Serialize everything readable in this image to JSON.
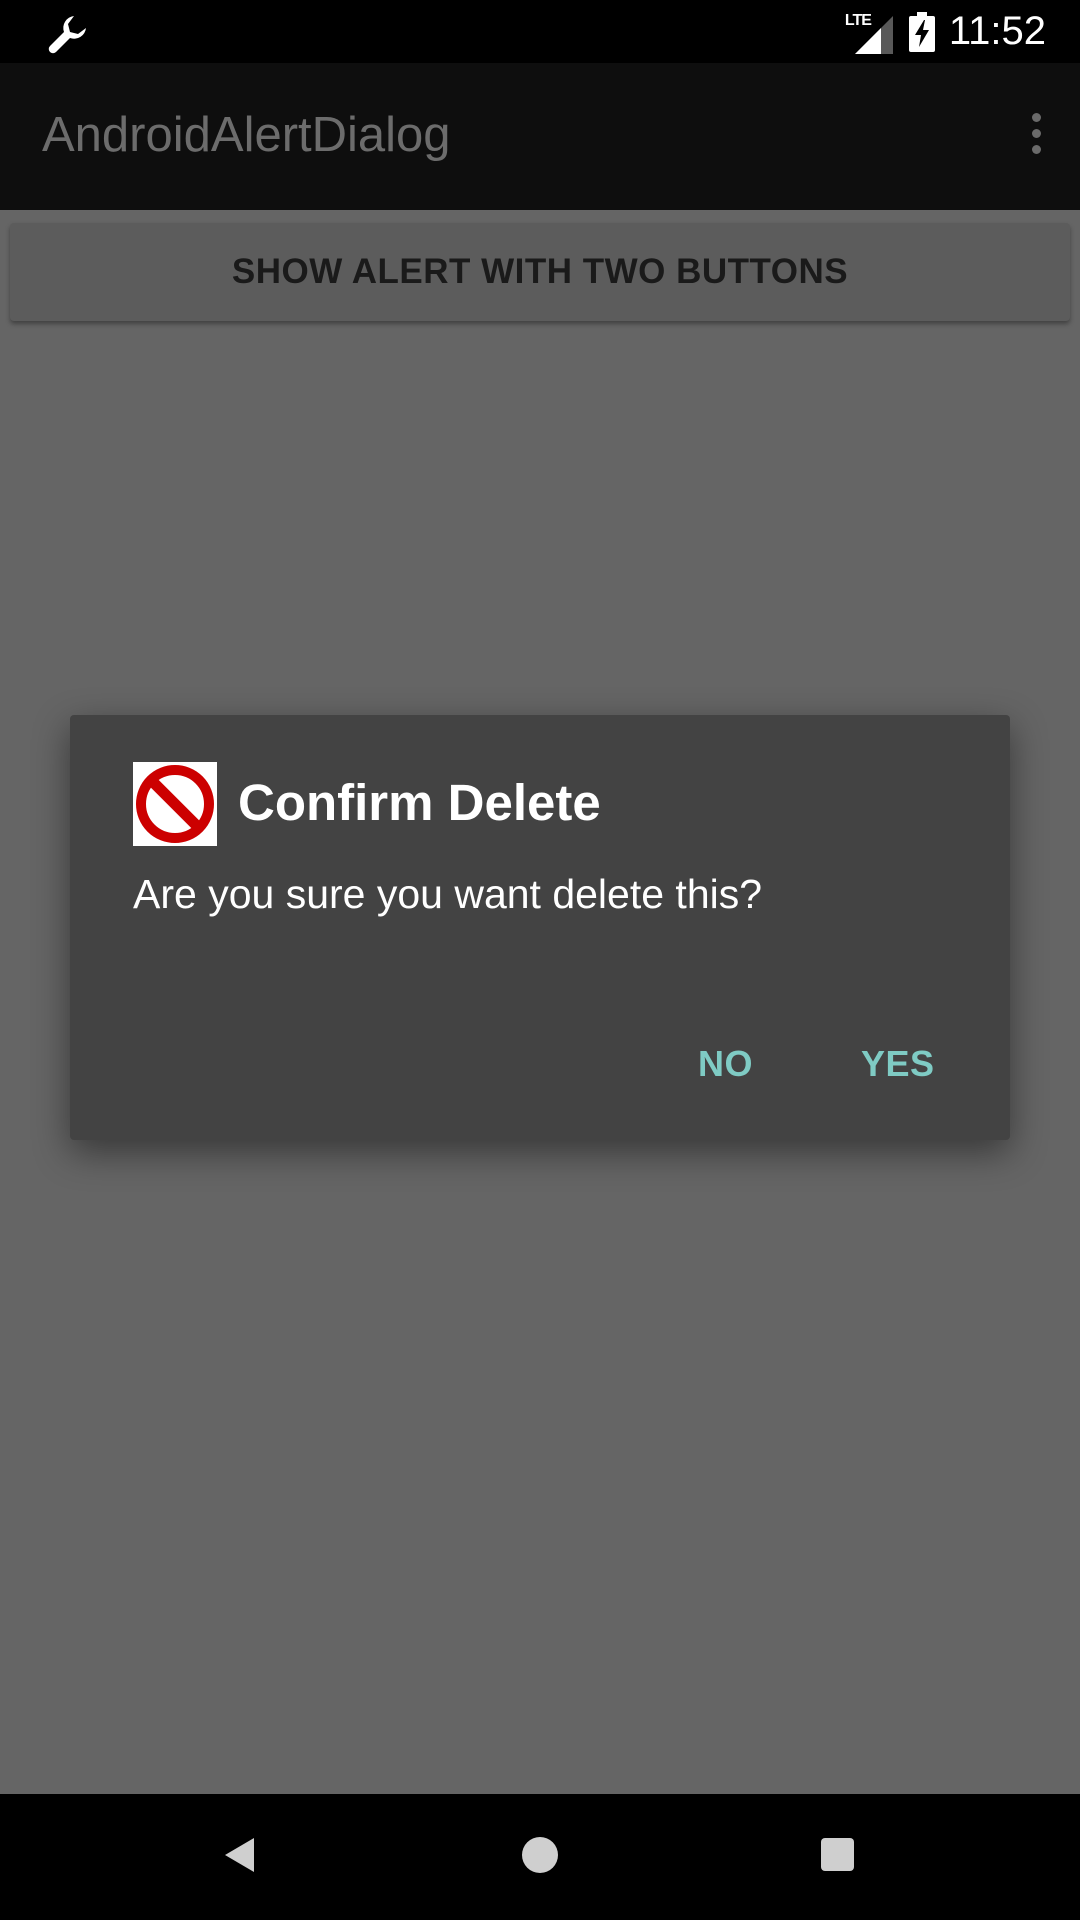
{
  "status_bar": {
    "network_label": "LTE",
    "time": "11:52",
    "icons": [
      "wrench-icon",
      "signal-icon",
      "battery-charging-icon"
    ]
  },
  "app_bar": {
    "title": "AndroidAlertDialog",
    "menu_icon": "overflow-menu-icon"
  },
  "main": {
    "show_alert_button_label": "SHOW ALERT WITH TWO BUTTONS"
  },
  "dialog": {
    "icon": "prohibited-icon",
    "title": "Confirm Delete",
    "message": "Are you sure you want delete this?",
    "negative_label": "NO",
    "positive_label": "YES"
  },
  "nav_bar": {
    "icons": [
      "back-icon",
      "home-icon",
      "recents-icon"
    ]
  },
  "colors": {
    "dialog_button_accent": "#7fcbc4",
    "prohibited_red": "#cc0000"
  }
}
